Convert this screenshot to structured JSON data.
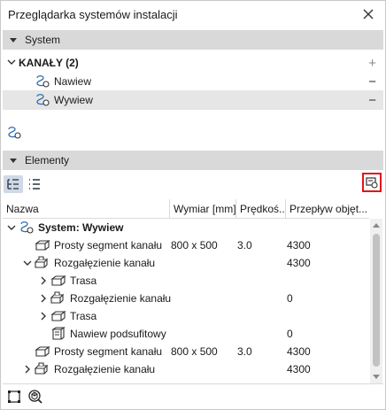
{
  "window": {
    "title": "Przeglądarka systemów instalacji"
  },
  "icons": {
    "close": "close-icon",
    "system": "duct-system-icon",
    "segment": "duct-segment-icon",
    "branch": "duct-branch-icon",
    "terminal": "air-terminal-icon"
  },
  "colors": {
    "section_bg": "#d9d9d9",
    "selected_bg": "#e6e6e6",
    "highlight_border": "#e0161b",
    "toggle_active": "#d0d9e6"
  },
  "system_section": {
    "title": "System",
    "group": {
      "label": "KANAŁY (2)",
      "action": "+"
    },
    "items": [
      {
        "label": "Nawiew",
        "action": "−"
      },
      {
        "label": "Wywiew",
        "action": "−"
      }
    ]
  },
  "elements_section": {
    "title": "Elementy",
    "columns": [
      "Nazwa",
      "Wymiar [mm]",
      "Prędkoś...",
      "Przepływ objęt..."
    ],
    "rows": [
      {
        "name": "System: Wywiew",
        "size": "",
        "speed": "",
        "flow": "",
        "level": 0,
        "expander": "open",
        "icon": "system",
        "bold": true
      },
      {
        "name": "Prosty segment kanału",
        "size": "800 x 500",
        "speed": "3.0",
        "flow": "4300",
        "level": 1,
        "expander": "none",
        "icon": "segment",
        "bold": false
      },
      {
        "name": "Rozgałęzienie kanału",
        "size": "",
        "speed": "",
        "flow": "4300",
        "level": 1,
        "expander": "open",
        "icon": "branch",
        "bold": false
      },
      {
        "name": "Trasa",
        "size": "",
        "speed": "",
        "flow": "",
        "level": 2,
        "expander": "closed",
        "icon": "segment",
        "bold": false
      },
      {
        "name": "Rozgałęzienie kanału",
        "size": "",
        "speed": "",
        "flow": "0",
        "level": 2,
        "expander": "closed",
        "icon": "branch",
        "bold": false
      },
      {
        "name": "Trasa",
        "size": "",
        "speed": "",
        "flow": "",
        "level": 2,
        "expander": "closed",
        "icon": "segment",
        "bold": false
      },
      {
        "name": "Nawiew podsufitowy",
        "size": "",
        "speed": "",
        "flow": "0",
        "level": 2,
        "expander": "none",
        "icon": "terminal",
        "bold": false
      },
      {
        "name": "Prosty segment kanału",
        "size": "800 x 500",
        "speed": "3.0",
        "flow": "4300",
        "level": 1,
        "expander": "none",
        "icon": "segment",
        "bold": false
      },
      {
        "name": "Rozgałęzienie kanału",
        "size": "",
        "speed": "",
        "flow": "4300",
        "level": 1,
        "expander": "closed",
        "icon": "branch",
        "bold": false
      }
    ]
  }
}
